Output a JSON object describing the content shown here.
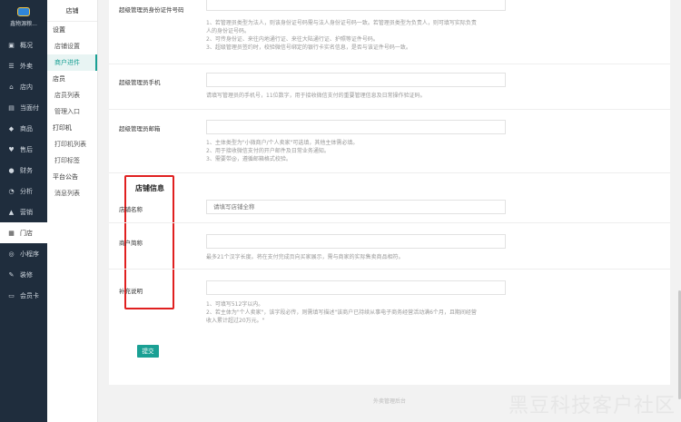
{
  "brand": {
    "name": "鑫物源粮..."
  },
  "nav": [
    {
      "icon": "▣",
      "icon_name": "overview-icon",
      "label": "概况"
    },
    {
      "icon": "☰",
      "icon_name": "takeout-icon",
      "label": "外卖"
    },
    {
      "icon": "⌂",
      "icon_name": "dine-in-icon",
      "label": "店内"
    },
    {
      "icon": "▤",
      "icon_name": "facepay-icon",
      "label": "当面付"
    },
    {
      "icon": "◆",
      "icon_name": "goods-icon",
      "label": "商品"
    },
    {
      "icon": "♥",
      "icon_name": "aftersale-icon",
      "label": "售后"
    },
    {
      "icon": "●",
      "icon_name": "finance-icon",
      "label": "财务"
    },
    {
      "icon": "◔",
      "icon_name": "analysis-icon",
      "label": "分析"
    },
    {
      "icon": "▲",
      "icon_name": "marketing-icon",
      "label": "营销"
    },
    {
      "icon": "▦",
      "icon_name": "store-icon",
      "label": "门店"
    },
    {
      "icon": "◎",
      "icon_name": "miniprogram-icon",
      "label": "小程序"
    },
    {
      "icon": "✎",
      "icon_name": "decoration-icon",
      "label": "装修"
    },
    {
      "icon": "▭",
      "icon_name": "member-card-icon",
      "label": "会员卡"
    }
  ],
  "subnav": {
    "title": "店铺",
    "settings": "设置",
    "shop_settings": "店铺设置",
    "merchant_onboard": "商户进件",
    "staff": "店员",
    "staff_list": "店员列表",
    "manage_entry": "管理入口",
    "print": "打印机",
    "printer_list": "打印机列表",
    "print_label": "打印标签",
    "announcement": "平台公告",
    "message_list": "消息列表"
  },
  "form": {
    "id_label": "超级管理员身份证件号码",
    "id_help": [
      "1、若管理员类型为法人，则该身份证号码需与法人身份证号码一致。若管理员类型为负责人，则可填写实际负责",
      "人的身份证号码。",
      "2、可传身份证、来往内地通行证、来往大陆通行证、护照等证件号码。",
      "3、超级管理员签约时，校验微信号绑定的银行卡实名信息，是否与该证件号码一致。"
    ],
    "phone_label": "超级管理员手机",
    "phone_help": "请填写管理员的手机号，11位数字，用于接收微信支付的重要管理信息及日常操作验证码。",
    "email_label": "超级管理员邮箱",
    "email_help": [
      "1、主体类型为\"小微商户/个人卖家\"可选填，其他主体需必填。",
      "2、用于接收微信支付的开户邮件及日常业务通知。",
      "3、需要带@，遵循邮箱格式校验。"
    ],
    "section_title": "店铺信息",
    "shop_name_label": "店铺名称",
    "shop_name_placeholder": "请填写店铺全称",
    "short_name_label": "商户简称",
    "short_name_help": "最多21个汉字长度。将在支付完成页向买家展示，需与商家的实际售卖商品相符。",
    "remark_label": "补充说明",
    "remark_help": [
      "1、可填写512字以内。",
      "2、若主体为\"个人卖家\"，该字段必传，则需填写描述\"该商户已持续从事电子商务经营活动满6个月，且期间经营",
      "收入累计超过20万元。\""
    ],
    "submit": "提交"
  },
  "footer": "外卖管理后台",
  "watermark": "黑豆科技客户社区",
  "colors": {
    "accent": "#1aa094",
    "sidebar": "#1f2d3d",
    "highlight_box": "#e02020"
  }
}
